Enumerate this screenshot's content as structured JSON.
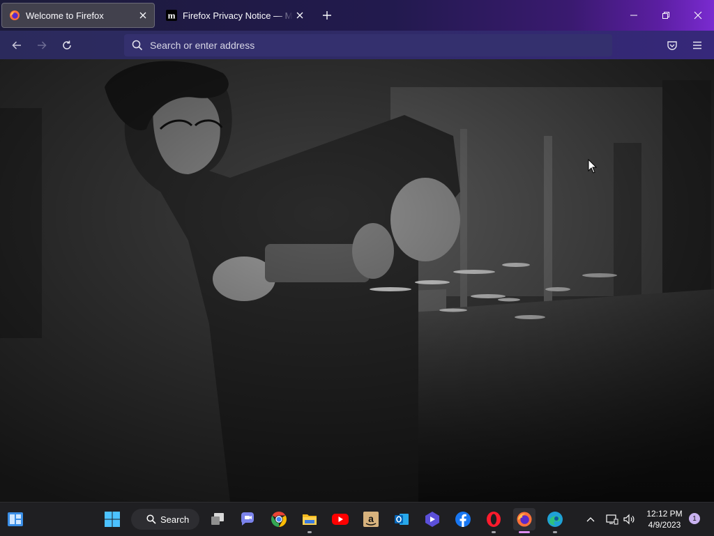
{
  "browser": {
    "tabs": [
      {
        "title": "Welcome to Firefox",
        "favicon": "firefox-icon",
        "active": true
      },
      {
        "title": "Firefox Privacy Notice — Mozilla",
        "favicon": "mozilla-m-icon",
        "active": false
      }
    ],
    "new_tab_icon": "plus-icon",
    "window_controls": [
      "minimize-icon",
      "restore-icon",
      "close-icon"
    ]
  },
  "navbar": {
    "back_icon": "back-arrow-icon",
    "forward_icon": "forward-arrow-icon",
    "reload_icon": "reload-icon",
    "search_icon": "search-icon",
    "address_placeholder": "Search or enter address",
    "address_value": "",
    "pocket_icon": "pocket-icon",
    "menu_icon": "hamburger-menu-icon"
  },
  "content": {
    "hero_image": "grayscale photo of a person using an angle grinder, sparks flying in a workshop"
  },
  "taskbar": {
    "start_icon": "windows-start-icon",
    "widgets_icon": "widgets-icon",
    "search_label": "Search",
    "apps": [
      {
        "name": "task-view-icon"
      },
      {
        "name": "teams-chat-icon"
      },
      {
        "name": "chrome-icon"
      },
      {
        "name": "file-explorer-icon",
        "running": true
      },
      {
        "name": "youtube-icon"
      },
      {
        "name": "amazon-icon"
      },
      {
        "name": "outlook-icon"
      },
      {
        "name": "clipchamp-icon"
      },
      {
        "name": "facebook-icon"
      },
      {
        "name": "opera-icon",
        "running": true
      },
      {
        "name": "firefox-icon",
        "running": true,
        "active": true
      },
      {
        "name": "edge-icon",
        "running": true
      }
    ],
    "tray": {
      "chevron_icon": "chevron-up-icon",
      "network_icon": "network-icon",
      "volume_icon": "volume-icon",
      "time": "12:12 PM",
      "date": "4/9/2023",
      "notification_count": "1"
    }
  },
  "colors": {
    "tabstrip_bg": "#1c1b3a",
    "navbar_bg": "#2b2a5c",
    "active_tab_bg": "#42414d",
    "accent_purple": "#7a2bd0",
    "taskbar_bg": "#1f1f22",
    "active_indicator": "#e08df0"
  }
}
